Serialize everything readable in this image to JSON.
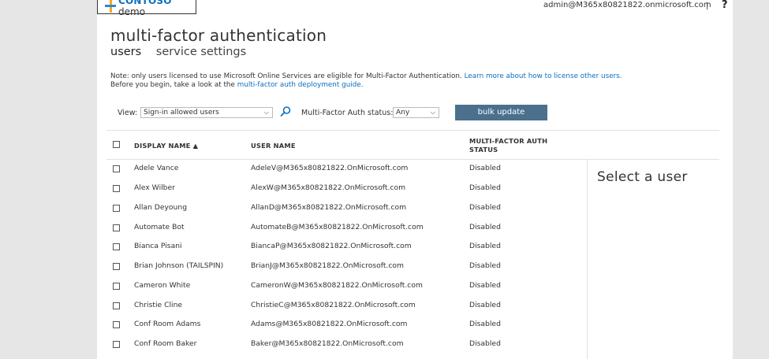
{
  "header": {
    "logo_brand": "CONTOSO",
    "logo_suffix": "demo",
    "account": "admin@M365x80821822.onmicrosoft.com",
    "separator": "|",
    "help": "?"
  },
  "page": {
    "title": "multi-factor authentication",
    "tabs": [
      {
        "label": "users"
      },
      {
        "label": "service settings"
      }
    ]
  },
  "note": {
    "line1_text": "Note: only users licensed to use Microsoft Online Services are eligible for Multi-Factor Authentication.",
    "line1_link": "Learn more about how to license other users.",
    "line2_text": "Before you begin, take a look at the",
    "line2_link": "multi-factor auth deployment guide."
  },
  "filters": {
    "view_label": "View:",
    "view_value": "Sign-in allowed users",
    "mfa_label": "Multi-Factor Auth status:",
    "mfa_value": "Any",
    "bulk_label": "bulk update"
  },
  "table": {
    "headers": {
      "display_name": "DISPLAY NAME ▲",
      "user_name": "USER NAME",
      "mfa_status_1": "MULTI-FACTOR AUTH",
      "mfa_status_2": "STATUS"
    },
    "rows": [
      {
        "name": "Adele Vance",
        "user": "AdeleV@M365x80821822.OnMicrosoft.com",
        "status": "Disabled"
      },
      {
        "name": "Alex Wilber",
        "user": "AlexW@M365x80821822.OnMicrosoft.com",
        "status": "Disabled"
      },
      {
        "name": "Allan Deyoung",
        "user": "AllanD@M365x80821822.OnMicrosoft.com",
        "status": "Disabled"
      },
      {
        "name": "Automate Bot",
        "user": "AutomateB@M365x80821822.OnMicrosoft.com",
        "status": "Disabled"
      },
      {
        "name": "Bianca Pisani",
        "user": "BiancaP@M365x80821822.OnMicrosoft.com",
        "status": "Disabled"
      },
      {
        "name": "Brian Johnson (TAILSPIN)",
        "user": "BrianJ@M365x80821822.OnMicrosoft.com",
        "status": "Disabled"
      },
      {
        "name": "Cameron White",
        "user": "CameronW@M365x80821822.OnMicrosoft.com",
        "status": "Disabled"
      },
      {
        "name": "Christie Cline",
        "user": "ChristieC@M365x80821822.OnMicrosoft.com",
        "status": "Disabled"
      },
      {
        "name": "Conf Room Adams",
        "user": "Adams@M365x80821822.OnMicrosoft.com",
        "status": "Disabled"
      },
      {
        "name": "Conf Room Baker",
        "user": "Baker@M365x80821822.OnMicrosoft.com",
        "status": "Disabled"
      }
    ]
  },
  "detail": {
    "placeholder": "Select a user"
  },
  "colors": {
    "accent": "#0b6fc1",
    "button": "#4a708e",
    "logo_orange": "#f5a623",
    "logo_blue": "#2b88d8"
  }
}
